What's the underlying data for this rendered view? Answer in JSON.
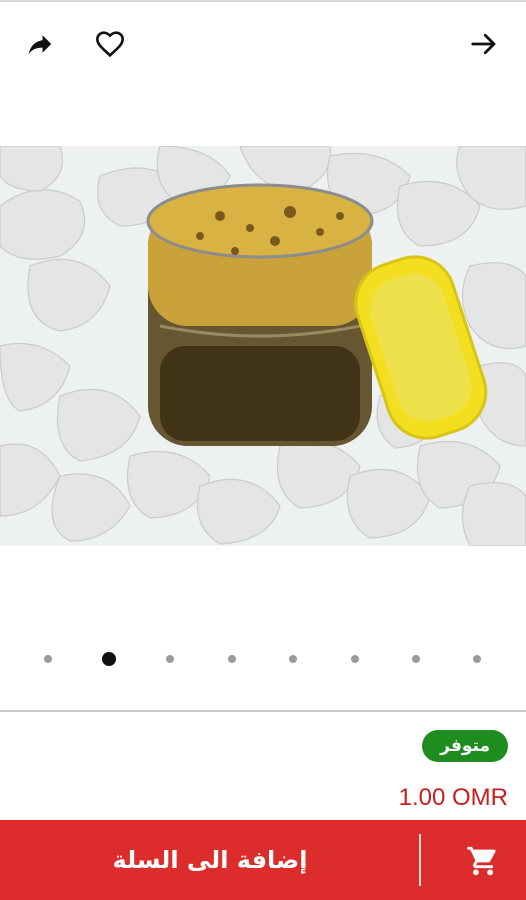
{
  "toolbar": {
    "share_icon": "share-icon",
    "favorite_icon": "heart-outline-icon",
    "forward_icon": "arrow-right-icon"
  },
  "gallery": {
    "image_description_icon": "product-image",
    "page_count": 8,
    "active_index": 1
  },
  "product": {
    "availability": "متوفر",
    "price": "1.00 OMR"
  },
  "cart": {
    "label": "إضافة الى السلة",
    "icon": "shopping-cart-icon"
  },
  "colors": {
    "availability_badge": "#1e8c1e",
    "price": "#c8201f",
    "cart_bar": "#dd2c2c"
  }
}
